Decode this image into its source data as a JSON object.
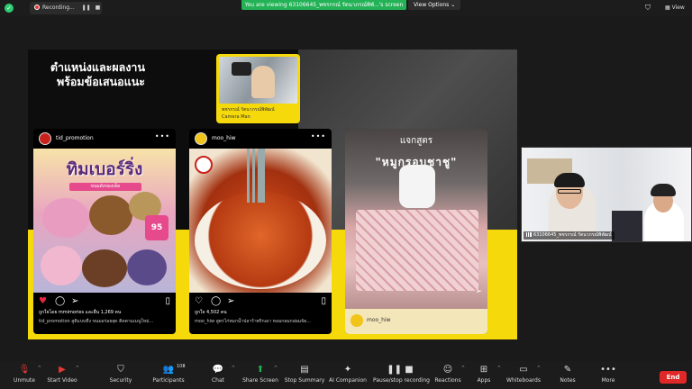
{
  "topbar": {
    "recording_label": "Recording...",
    "pause_icon": "pause-icon",
    "stop_icon": "stop-icon",
    "viewing_text": "You are viewing 63106645_พชรกรณ์ รัตนาภรณ์พิพั...'s screen",
    "view_options_label": "View Options",
    "view_label": "View",
    "colors": {
      "viewing_banner": "#23b256",
      "recording_dot": "#e53935"
    }
  },
  "slide": {
    "title": "ตำแหน่งและผลงาน พร้อมข้อเสนอแนะ",
    "profile": {
      "name": "พชรกรณ์ รัตนาภรณ์พิพัฒน์",
      "role": "Camera Man"
    },
    "posts": [
      {
        "user": "tid_promotion",
        "headline": "ทิมเบอร์ริ่ง",
        "sub": "ขนมดังของเด็ด",
        "price": "95",
        "likes": "ถูกใจโดย mmimories และอื่น 1,269 คน",
        "caption": "tid_promotion สูติแบบที่ง ขนมอร่อยสุด ติดตามเมนูใหม่..."
      },
      {
        "user": "moo_hiw",
        "likes": "ถูกใจ 4,502 คน",
        "caption": "moo_hiw สูตรไก่หมกน้ำปลาร้าพริกเผา หอมกลมกล่อมจัด..."
      },
      {
        "title_top": "แจกสูตร",
        "title": "\"หมูกรอบชาชู\"",
        "user": "moo_hiw"
      }
    ]
  },
  "video": {
    "participant_label": "63106645_พชรกรณ์ รัตนาภรณ์พิพัฒน์"
  },
  "toolbar": {
    "items": [
      {
        "label": "Unmute",
        "icon": "mic-muted-icon"
      },
      {
        "label": "Start Video",
        "icon": "video-off-icon"
      },
      {
        "label": "Security",
        "icon": "shield-icon"
      },
      {
        "label": "Participants",
        "icon": "people-icon",
        "count": "108"
      },
      {
        "label": "Chat",
        "icon": "chat-icon"
      },
      {
        "label": "Share Screen",
        "icon": "share-screen-icon"
      },
      {
        "label": "Stop Summary",
        "icon": "summary-icon"
      },
      {
        "label": "AI Companion",
        "icon": "ai-sparkle-icon"
      },
      {
        "label": "Pause/stop recording",
        "icon": "record-icon"
      },
      {
        "label": "Reactions",
        "icon": "reactions-icon"
      },
      {
        "label": "Apps",
        "icon": "apps-icon"
      },
      {
        "label": "Whiteboards",
        "icon": "whiteboard-icon"
      },
      {
        "label": "Notes",
        "icon": "notes-icon"
      },
      {
        "label": "More",
        "icon": "more-icon"
      }
    ],
    "end_label": "End",
    "colors": {
      "end": "#e02828",
      "share": "#23b256"
    }
  }
}
